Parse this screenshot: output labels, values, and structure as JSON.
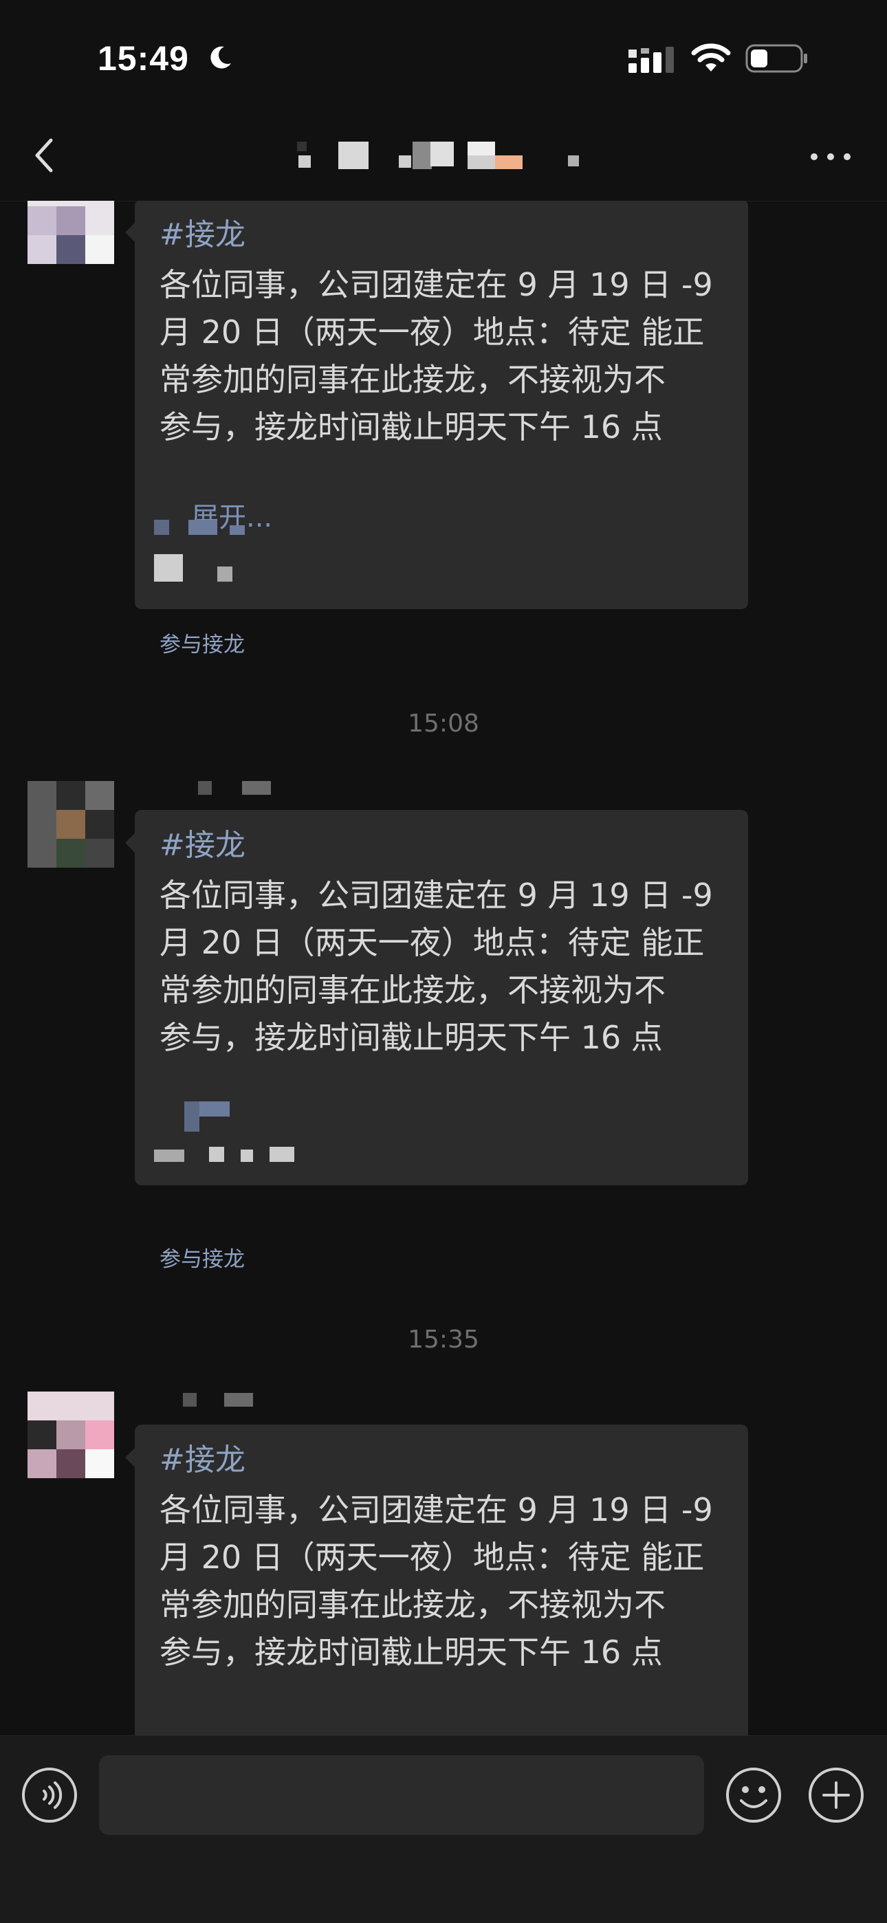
{
  "status_bar": {
    "time": "15:49",
    "icons": [
      "moon-icon",
      "cellular-signal-icon",
      "wifi-icon",
      "battery-icon"
    ]
  },
  "nav": {
    "back_icon": "chevron-left-icon",
    "more_icon": "more-dots-icon"
  },
  "messages": [
    {
      "tag": "#接龙",
      "lines": [
        "各位同事，公司团建定在 9 月 19 日 -9",
        "月 20 日（两天一夜）地点：待定  能正",
        "常参加的同事在此接龙，不接视为不",
        "参与，接龙时间截止明天下午 16 点"
      ],
      "expand": "展开..."
    },
    {
      "tag": "#接龙",
      "lines": [
        "各位同事，公司团建定在 9 月 19 日 -9",
        "月 20 日（两天一夜）地点：待定  能正",
        "常参加的同事在此接龙，不接视为不",
        "参与，接龙时间截止明天下午 16 点"
      ]
    },
    {
      "tag": "#接龙",
      "lines": [
        "各位同事，公司团建定在 9 月 19 日 -9",
        "月 20 日（两天一夜）地点：待定  能正",
        "常参加的同事在此接龙，不接视为不",
        "参与，接龙时间截止明天下午 16 点"
      ]
    }
  ],
  "join_label": "参与接龙",
  "timestamps": [
    "15:08",
    "15:35"
  ],
  "input_bar": {
    "voice_icon": "voice-icon",
    "emoji_icon": "emoji-icon",
    "plus_icon": "plus-icon"
  },
  "colors": {
    "background": "#111111",
    "bubble": "#2c2c2c",
    "link": "#8fa3c4",
    "text": "#d9d9d9"
  }
}
